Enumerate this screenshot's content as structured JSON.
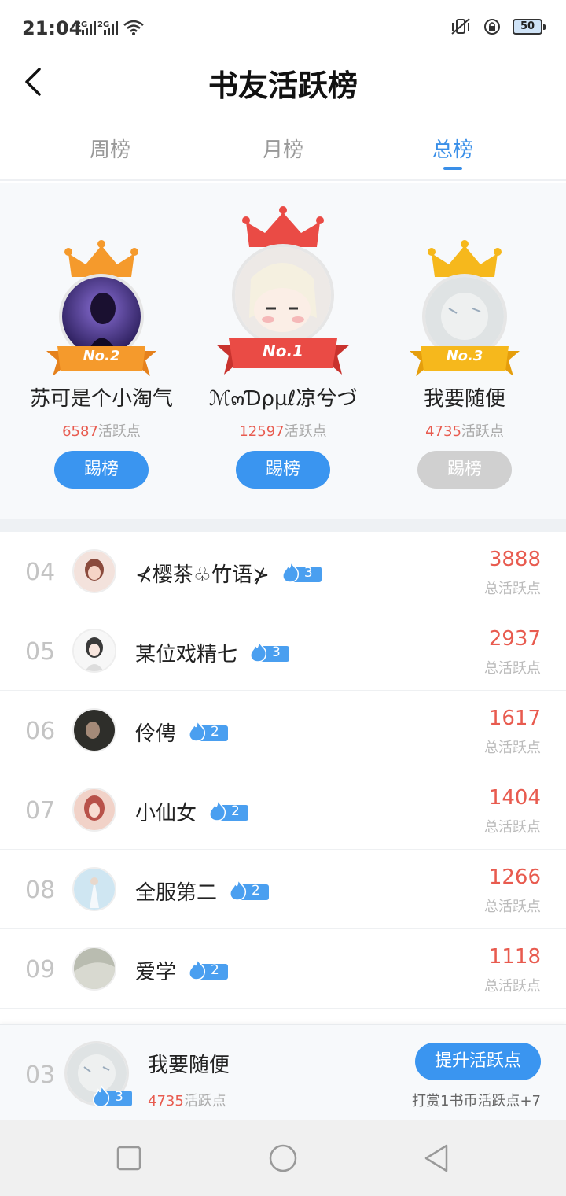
{
  "status_bar": {
    "time": "21:04",
    "signal1": "2G",
    "signal2": "2G",
    "battery": "50"
  },
  "header": {
    "title": "书友活跃榜"
  },
  "tabs": [
    {
      "label": "周榜",
      "active": false
    },
    {
      "label": "月榜",
      "active": false
    },
    {
      "label": "总榜",
      "active": true
    }
  ],
  "podium": [
    {
      "badge": "No.2",
      "name": "苏可是个小淘气",
      "score": "6587",
      "score_unit": "活跃点",
      "button": "踢榜",
      "button_enabled": true,
      "crown_color": "#f59a2c"
    },
    {
      "badge": "No.1",
      "name": "ℳ๓Ɗρµℓ凉兮づ",
      "score": "12597",
      "score_unit": "活跃点",
      "button": "踢榜",
      "button_enabled": true,
      "crown_color": "#ea4b45"
    },
    {
      "badge": "No.3",
      "name": "我要随便",
      "score": "4735",
      "score_unit": "活跃点",
      "button": "踢榜",
      "button_enabled": false,
      "crown_color": "#f6b81c"
    }
  ],
  "list": [
    {
      "rank": "04",
      "name": "⊀樱茶♧竹语⊁",
      "level": "3",
      "score": "3888",
      "score_label": "总活跃点"
    },
    {
      "rank": "05",
      "name": "某位戏精七",
      "level": "3",
      "score": "2937",
      "score_label": "总活跃点"
    },
    {
      "rank": "06",
      "name": "伶俜",
      "level": "2",
      "score": "1617",
      "score_label": "总活跃点"
    },
    {
      "rank": "07",
      "name": "小仙女",
      "level": "2",
      "score": "1404",
      "score_label": "总活跃点"
    },
    {
      "rank": "08",
      "name": "全服第二",
      "level": "2",
      "score": "1266",
      "score_label": "总活跃点"
    },
    {
      "rank": "09",
      "name": "爱学",
      "level": "2",
      "score": "1118",
      "score_label": "总活跃点"
    }
  ],
  "me": {
    "rank": "03",
    "name": "我要随便",
    "level": "3",
    "score": "4735",
    "score_unit": "活跃点",
    "button": "提升活跃点",
    "hint": "打赏1书币活跃点+7"
  },
  "colors": {
    "accent": "#3a95f0",
    "score": "#e85b4f",
    "disabled": "#d0d0d0"
  }
}
